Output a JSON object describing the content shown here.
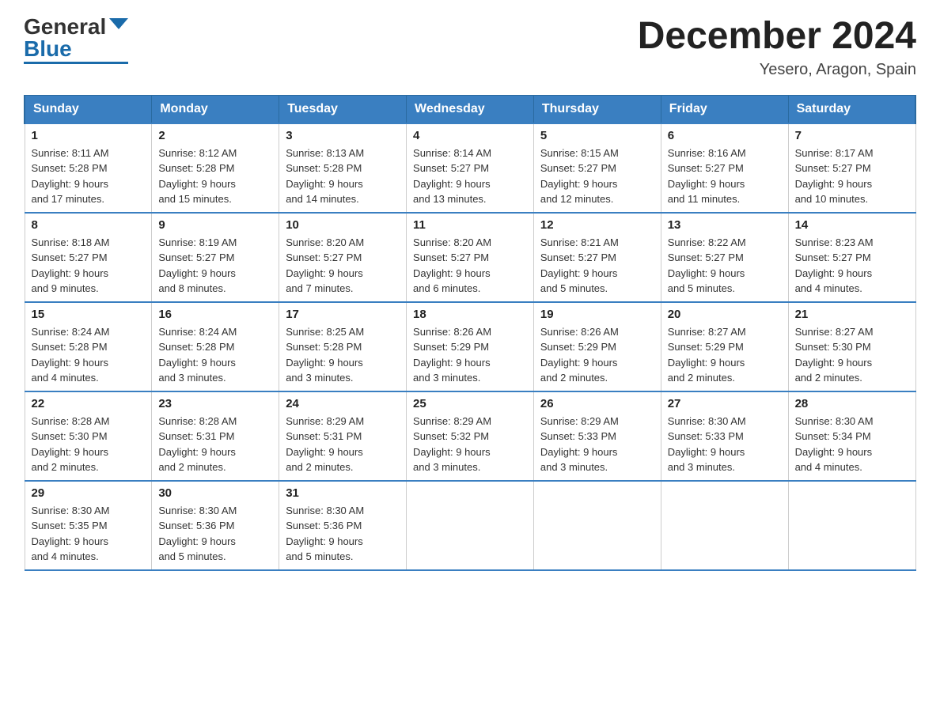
{
  "header": {
    "logo": {
      "general_text": "General",
      "blue_text": "Blue"
    },
    "title": "December 2024",
    "location": "Yesero, Aragon, Spain"
  },
  "weekdays": [
    "Sunday",
    "Monday",
    "Tuesday",
    "Wednesday",
    "Thursday",
    "Friday",
    "Saturday"
  ],
  "weeks": [
    [
      {
        "day": "1",
        "sunrise": "8:11 AM",
        "sunset": "5:28 PM",
        "daylight": "9 hours and 17 minutes."
      },
      {
        "day": "2",
        "sunrise": "8:12 AM",
        "sunset": "5:28 PM",
        "daylight": "9 hours and 15 minutes."
      },
      {
        "day": "3",
        "sunrise": "8:13 AM",
        "sunset": "5:28 PM",
        "daylight": "9 hours and 14 minutes."
      },
      {
        "day": "4",
        "sunrise": "8:14 AM",
        "sunset": "5:27 PM",
        "daylight": "9 hours and 13 minutes."
      },
      {
        "day": "5",
        "sunrise": "8:15 AM",
        "sunset": "5:27 PM",
        "daylight": "9 hours and 12 minutes."
      },
      {
        "day": "6",
        "sunrise": "8:16 AM",
        "sunset": "5:27 PM",
        "daylight": "9 hours and 11 minutes."
      },
      {
        "day": "7",
        "sunrise": "8:17 AM",
        "sunset": "5:27 PM",
        "daylight": "9 hours and 10 minutes."
      }
    ],
    [
      {
        "day": "8",
        "sunrise": "8:18 AM",
        "sunset": "5:27 PM",
        "daylight": "9 hours and 9 minutes."
      },
      {
        "day": "9",
        "sunrise": "8:19 AM",
        "sunset": "5:27 PM",
        "daylight": "9 hours and 8 minutes."
      },
      {
        "day": "10",
        "sunrise": "8:20 AM",
        "sunset": "5:27 PM",
        "daylight": "9 hours and 7 minutes."
      },
      {
        "day": "11",
        "sunrise": "8:20 AM",
        "sunset": "5:27 PM",
        "daylight": "9 hours and 6 minutes."
      },
      {
        "day": "12",
        "sunrise": "8:21 AM",
        "sunset": "5:27 PM",
        "daylight": "9 hours and 5 minutes."
      },
      {
        "day": "13",
        "sunrise": "8:22 AM",
        "sunset": "5:27 PM",
        "daylight": "9 hours and 5 minutes."
      },
      {
        "day": "14",
        "sunrise": "8:23 AM",
        "sunset": "5:27 PM",
        "daylight": "9 hours and 4 minutes."
      }
    ],
    [
      {
        "day": "15",
        "sunrise": "8:24 AM",
        "sunset": "5:28 PM",
        "daylight": "9 hours and 4 minutes."
      },
      {
        "day": "16",
        "sunrise": "8:24 AM",
        "sunset": "5:28 PM",
        "daylight": "9 hours and 3 minutes."
      },
      {
        "day": "17",
        "sunrise": "8:25 AM",
        "sunset": "5:28 PM",
        "daylight": "9 hours and 3 minutes."
      },
      {
        "day": "18",
        "sunrise": "8:26 AM",
        "sunset": "5:29 PM",
        "daylight": "9 hours and 3 minutes."
      },
      {
        "day": "19",
        "sunrise": "8:26 AM",
        "sunset": "5:29 PM",
        "daylight": "9 hours and 2 minutes."
      },
      {
        "day": "20",
        "sunrise": "8:27 AM",
        "sunset": "5:29 PM",
        "daylight": "9 hours and 2 minutes."
      },
      {
        "day": "21",
        "sunrise": "8:27 AM",
        "sunset": "5:30 PM",
        "daylight": "9 hours and 2 minutes."
      }
    ],
    [
      {
        "day": "22",
        "sunrise": "8:28 AM",
        "sunset": "5:30 PM",
        "daylight": "9 hours and 2 minutes."
      },
      {
        "day": "23",
        "sunrise": "8:28 AM",
        "sunset": "5:31 PM",
        "daylight": "9 hours and 2 minutes."
      },
      {
        "day": "24",
        "sunrise": "8:29 AM",
        "sunset": "5:31 PM",
        "daylight": "9 hours and 2 minutes."
      },
      {
        "day": "25",
        "sunrise": "8:29 AM",
        "sunset": "5:32 PM",
        "daylight": "9 hours and 3 minutes."
      },
      {
        "day": "26",
        "sunrise": "8:29 AM",
        "sunset": "5:33 PM",
        "daylight": "9 hours and 3 minutes."
      },
      {
        "day": "27",
        "sunrise": "8:30 AM",
        "sunset": "5:33 PM",
        "daylight": "9 hours and 3 minutes."
      },
      {
        "day": "28",
        "sunrise": "8:30 AM",
        "sunset": "5:34 PM",
        "daylight": "9 hours and 4 minutes."
      }
    ],
    [
      {
        "day": "29",
        "sunrise": "8:30 AM",
        "sunset": "5:35 PM",
        "daylight": "9 hours and 4 minutes."
      },
      {
        "day": "30",
        "sunrise": "8:30 AM",
        "sunset": "5:36 PM",
        "daylight": "9 hours and 5 minutes."
      },
      {
        "day": "31",
        "sunrise": "8:30 AM",
        "sunset": "5:36 PM",
        "daylight": "9 hours and 5 minutes."
      },
      null,
      null,
      null,
      null
    ]
  ],
  "labels": {
    "sunrise": "Sunrise:",
    "sunset": "Sunset:",
    "daylight": "Daylight:"
  }
}
